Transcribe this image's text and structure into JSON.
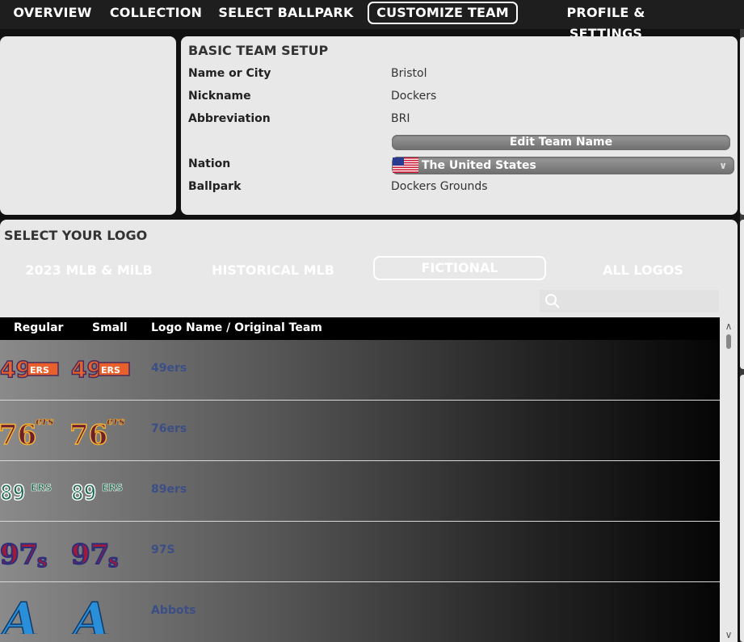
{
  "nav": {
    "tabs": [
      "OVERVIEW",
      "COLLECTION",
      "SELECT BALLPARK",
      "CUSTOMIZE TEAM",
      "PROFILE & SETTINGS"
    ],
    "active": "CUSTOMIZE TEAM"
  },
  "setup": {
    "title": "BASIC TEAM SETUP",
    "name_label": "Name or City",
    "name_value": "Bristol",
    "nickname_label": "Nickname",
    "nickname_value": "Dockers",
    "abbr_label": "Abbreviation",
    "abbr_value": "BRI",
    "edit_button": "Edit Team Name",
    "nation_label": "Nation",
    "nation_value": "The United States",
    "ballpark_label": "Ballpark",
    "ballpark_value": "Dockers Grounds"
  },
  "logos": {
    "title": "SELECT YOUR LOGO",
    "tabs": [
      "2023 MLB & MiLB",
      "HISTORICAL MLB",
      "FICTIONAL",
      "ALL LOGOS"
    ],
    "active_tab": "FICTIONAL",
    "search_value": "",
    "columns": [
      "Regular",
      "Small",
      "Logo Name / Original Team"
    ],
    "rows": [
      {
        "name": "49ers",
        "icon": "49ers-logo"
      },
      {
        "name": "76ers",
        "icon": "76ers-logo"
      },
      {
        "name": "89ers",
        "icon": "89ers-logo"
      },
      {
        "name": "97S",
        "icon": "97s-logo"
      },
      {
        "name": "Abbots",
        "icon": "abbots-logo"
      }
    ]
  },
  "colors": {
    "accent": "#3b4f86",
    "panel": "#e8e8e8",
    "background": "#111111"
  }
}
